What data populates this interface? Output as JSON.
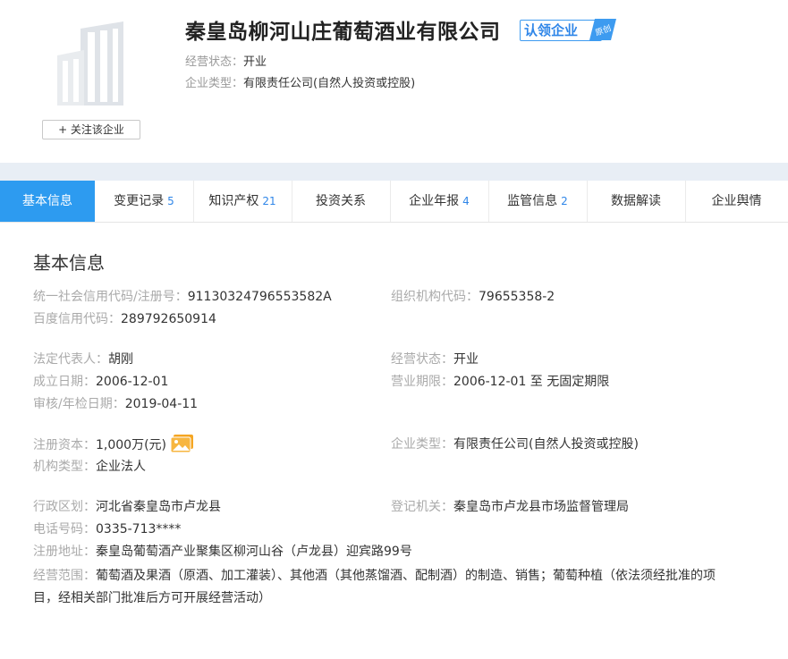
{
  "company": {
    "name": "秦皇岛柳河山庄葡萄酒业有限公司",
    "claim_label": "认领企业",
    "claim_tag": "原创",
    "status_label": "经营状态：",
    "status_value": "开业",
    "type_label": "企业类型：",
    "type_value": "有限责任公司(自然人投资或控股)",
    "follow_label": "+ 关注该企业"
  },
  "tabs": [
    {
      "label": "基本信息",
      "count": ""
    },
    {
      "label": "变更记录",
      "count": "5"
    },
    {
      "label": "知识产权",
      "count": "21"
    },
    {
      "label": "投资关系",
      "count": ""
    },
    {
      "label": "企业年报",
      "count": "4"
    },
    {
      "label": "监管信息",
      "count": "2"
    },
    {
      "label": "数据解读",
      "count": ""
    },
    {
      "label": "企业舆情",
      "count": ""
    }
  ],
  "section_title": "基本信息",
  "fields": {
    "credit_code": {
      "label": "统一社会信用代码/注册号：",
      "value": "91130324796553582A"
    },
    "org_code": {
      "label": "组织机构代码：",
      "value": "79655358-2"
    },
    "baidu_code": {
      "label": "百度信用代码：",
      "value": "289792650914"
    },
    "legal_rep": {
      "label": "法定代表人：",
      "value": "胡刚"
    },
    "status": {
      "label": "经营状态：",
      "value": "开业"
    },
    "founded": {
      "label": "成立日期：",
      "value": "2006-12-01"
    },
    "term": {
      "label": "营业期限：",
      "value": "2006-12-01 至 无固定期限"
    },
    "audit_date": {
      "label": "审核/年检日期：",
      "value": "2019-04-11"
    },
    "capital": {
      "label": "注册资本：",
      "value": "1,000万(元)"
    },
    "company_type": {
      "label": "企业类型：",
      "value": "有限责任公司(自然人投资或控股)"
    },
    "org_type": {
      "label": "机构类型：",
      "value": "企业法人"
    },
    "region": {
      "label": "行政区划：",
      "value": "河北省秦皇岛市卢龙县"
    },
    "authority": {
      "label": "登记机关：",
      "value": "秦皇岛市卢龙县市场监督管理局"
    },
    "phone": {
      "label": "电话号码：",
      "value": "0335-713****"
    },
    "address": {
      "label": "注册地址：",
      "value": "秦皇岛葡萄酒产业聚集区柳河山谷（卢龙县）迎宾路99号"
    },
    "scope": {
      "label": "经营范围：",
      "value": "葡萄酒及果酒（原酒、加工灌装）、其他酒（其他蒸馏酒、配制酒）的制造、销售；葡萄种植（依法须经批准的项目，经相关部门批准后方可开展经营活动）"
    }
  },
  "icons": {
    "logo": "building-icon",
    "capital_image": "image-icon"
  },
  "colors": {
    "accent": "#2d9bf0",
    "count": "#2f86e8",
    "label": "#aaaaaa"
  }
}
